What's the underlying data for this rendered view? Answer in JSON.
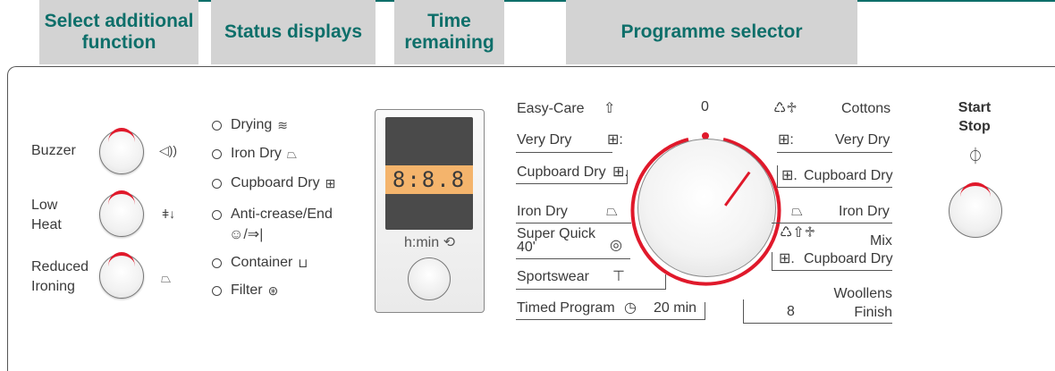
{
  "headers": {
    "additional": "Select additional function",
    "status": "Status displays",
    "time": "Time remaining",
    "programme": "Programme selector"
  },
  "functions": [
    {
      "label": "Buzzer",
      "icon": "speaker-icon",
      "glyph": "◁))"
    },
    {
      "label": "Low Heat",
      "icon": "thermometer-icon",
      "glyph": "ǂ↓"
    },
    {
      "label": "Reduced Ironing",
      "icon": "iron-icon",
      "glyph": "⏢"
    }
  ],
  "status": [
    {
      "label": "Drying",
      "glyph": "≋"
    },
    {
      "label": "Iron Dry",
      "glyph": "⏢"
    },
    {
      "label": "Cupboard Dry",
      "glyph": "⊞"
    },
    {
      "label": "Anti-crease/End",
      "glyph": "☺/⇒|"
    },
    {
      "label": "Container",
      "glyph": "⊔"
    },
    {
      "label": "Filter",
      "glyph": "⊛"
    }
  ],
  "timer": {
    "display": "8:8.8",
    "unit": "h:min ⟲"
  },
  "programmes_left": [
    {
      "label": "Easy-Care",
      "glyph": "⇧"
    },
    {
      "label": "Very Dry",
      "glyph": "⊞:"
    },
    {
      "label": "Cupboard Dry",
      "glyph": "⊞."
    },
    {
      "label": "Iron Dry",
      "glyph": "⏢"
    },
    {
      "label": "Super Quick 40'",
      "glyph": "◎"
    },
    {
      "label": "Sportswear",
      "glyph": "⊤"
    },
    {
      "label": "Timed Program",
      "glyph": "◷",
      "extra": "20 min"
    }
  ],
  "programmes_right": [
    {
      "label": "Cottons",
      "glyph": "♺♱"
    },
    {
      "label": "Very Dry",
      "glyph": "⊞:"
    },
    {
      "label": "Cupboard Dry",
      "glyph": "⊞."
    },
    {
      "label": "Iron Dry",
      "glyph": "⏢"
    },
    {
      "label": "Mix",
      "glyph": "♺⇧♱"
    },
    {
      "label": "Cupboard Dry",
      "glyph": "⊞."
    },
    {
      "label": "Woollens Finish",
      "glyph": "8"
    }
  ],
  "dial_zero": "0",
  "start_stop": {
    "line1": "Start",
    "line2": "Stop",
    "glyph": "⏀"
  },
  "colors": {
    "accent": "#e0192b",
    "header_text": "#0e6f6a",
    "header_bg": "#d3d3d3",
    "lcd_window": "#f4b46c"
  }
}
